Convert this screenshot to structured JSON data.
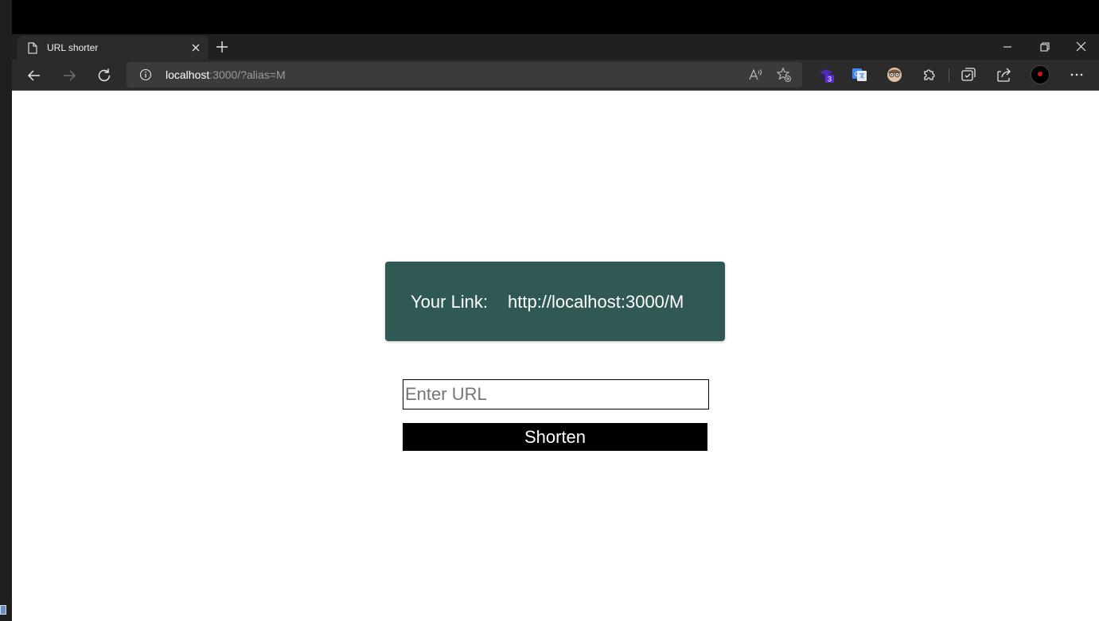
{
  "browser": {
    "tab": {
      "title": "URL shorter",
      "icon": "page-icon"
    },
    "address": {
      "host": "localhost",
      "rest": ":3000/?alias=M"
    },
    "extensions": [
      {
        "name": "extension-stack-icon",
        "badge": "3"
      },
      {
        "name": "google-translate-icon"
      },
      {
        "name": "extension-face-icon"
      }
    ]
  },
  "page": {
    "result_label": "Your Link:",
    "result_link": "http://localhost:3000/M",
    "input_placeholder": "Enter URL",
    "input_value": "",
    "button_label": "Shorten"
  },
  "colors": {
    "result_bg": "#305955",
    "button_bg": "#000000"
  }
}
